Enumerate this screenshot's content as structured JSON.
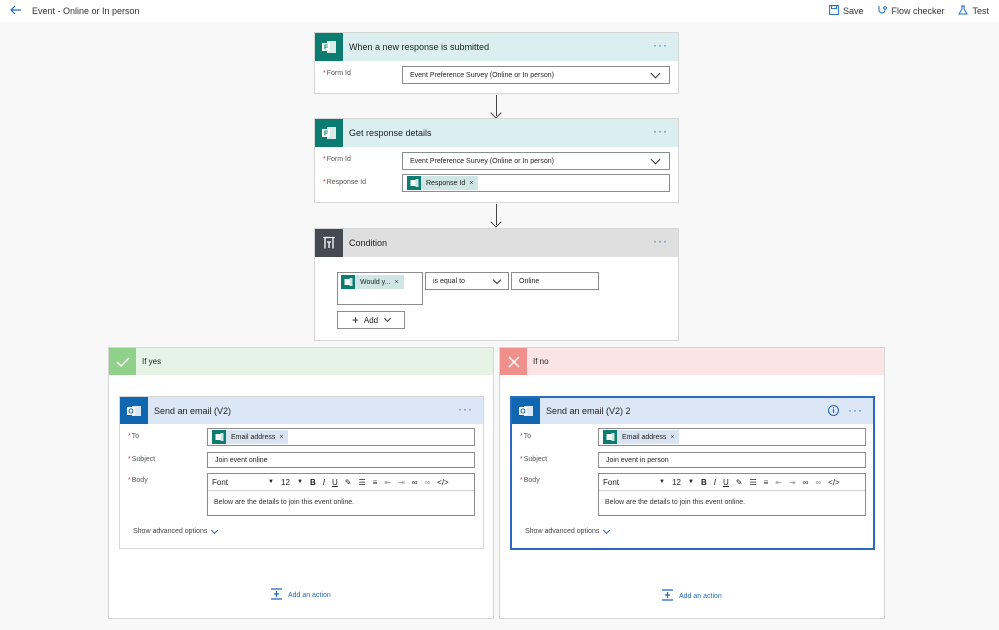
{
  "header": {
    "title": "Event - Online or In person",
    "save": "Save",
    "flow_checker": "Flow checker",
    "test": "Test"
  },
  "trigger": {
    "title": "When a new response is submitted",
    "form_id_label": "Form Id",
    "form_id_value": "Event Preference Survey (Online or In person)"
  },
  "get_details": {
    "title": "Get response details",
    "form_id_label": "Form Id",
    "form_id_value": "Event Preference Survey (Online or In person)",
    "response_id_label": "Response Id",
    "response_token": "Response Id"
  },
  "condition": {
    "title": "Condition",
    "left_token": "Would y...",
    "operator": "is equal to",
    "value": "Online",
    "add_label": "Add"
  },
  "yes_branch": {
    "label": "If yes",
    "action_title": "Send an email (V2)",
    "to_label": "To",
    "to_token": "Email address",
    "subject_label": "Subject",
    "subject_value": "Join event online",
    "body_label": "Body",
    "font": "Font",
    "font_size": "12",
    "body_text": "Below are the details to join this event online.",
    "advanced": "Show advanced options",
    "add_action": "Add an action"
  },
  "no_branch": {
    "label": "If no",
    "action_title": "Send an email (V2) 2",
    "to_label": "To",
    "to_token": "Email address",
    "subject_label": "Subject",
    "subject_value": "Join event in person",
    "body_label": "Body",
    "font": "Font",
    "font_size": "12",
    "body_text": "Below are the details to join this event online.",
    "advanced": "Show advanced options",
    "add_action": "Add an action"
  },
  "icons": [
    "back-arrow-icon",
    "save-icon",
    "flow-checker-icon",
    "test-icon",
    "forms-icon",
    "condition-icon",
    "outlook-icon",
    "check-icon",
    "close-icon",
    "more-icon",
    "info-icon",
    "add-action-icon"
  ],
  "colors": {
    "accent": "#2667b8",
    "forms": "#0a7d70",
    "outlook": "#0f67b2",
    "yes": "#8fd18a",
    "no": "#f0908c"
  }
}
